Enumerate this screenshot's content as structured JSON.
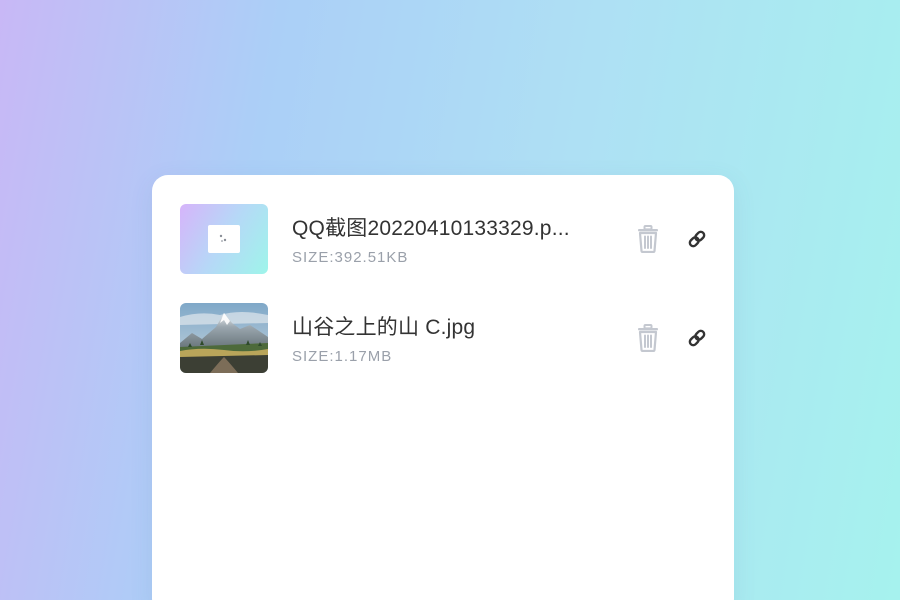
{
  "files": [
    {
      "name": "QQ截图20220410133329.p...",
      "size": "SIZE:392.51KB",
      "thumbnail_icon": "image-placeholder-icon"
    },
    {
      "name": "山谷之上的山 C.jpg",
      "size": "SIZE:1.17MB",
      "thumbnail_icon": "mountain-landscape-thumbnail"
    }
  ],
  "actions": {
    "delete_icon": "trash-icon",
    "copy_link_icon": "link-icon"
  },
  "colors": {
    "icon_grey": "#c4c8d0",
    "icon_dark": "#333333",
    "name_text": "#333333",
    "size_text": "#9aa0aa",
    "panel_bg": "#ffffff"
  }
}
